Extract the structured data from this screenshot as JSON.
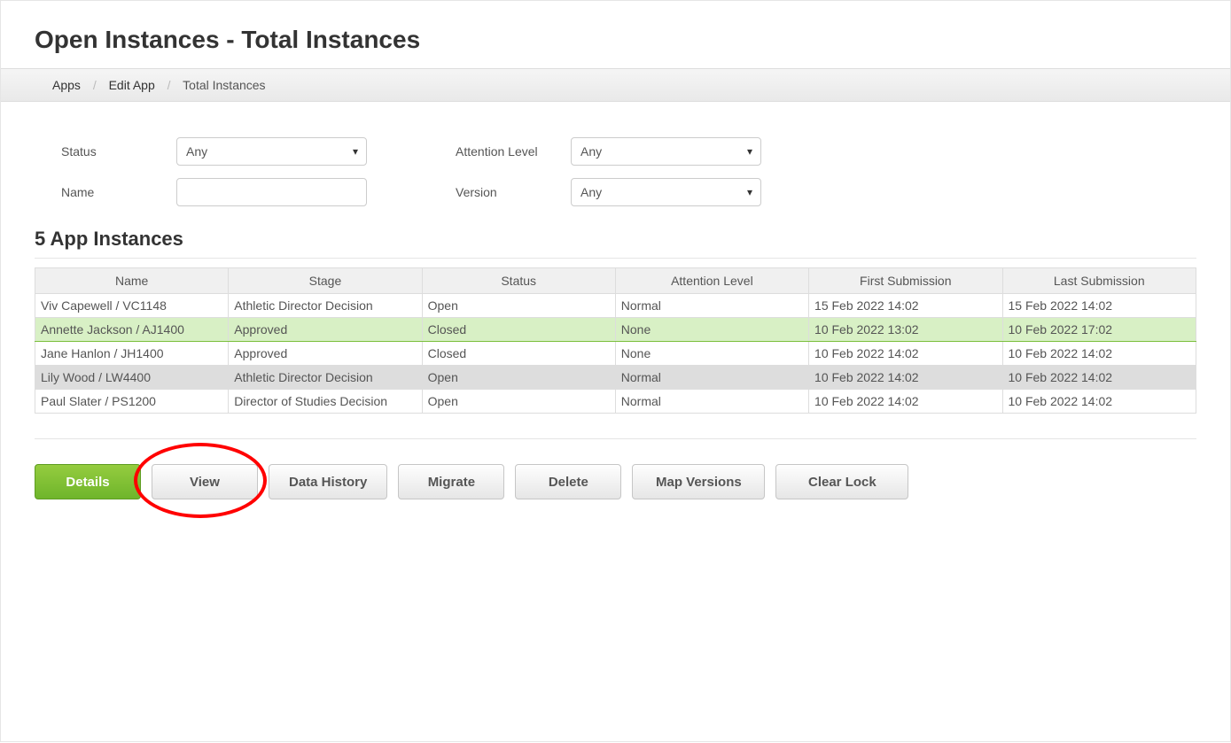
{
  "page_title": "Open Instances - Total Instances",
  "breadcrumb": {
    "root": "Apps",
    "mid": "Edit App",
    "leaf": "Total Instances"
  },
  "filters": {
    "status_label": "Status",
    "status_value": "Any",
    "name_label": "Name",
    "name_value": "",
    "attention_label": "Attention Level",
    "attention_value": "Any",
    "version_label": "Version",
    "version_value": "Any"
  },
  "instances_title": "5 App Instances",
  "table": {
    "headers": {
      "name": "Name",
      "stage": "Stage",
      "status": "Status",
      "attention": "Attention Level",
      "first": "First Submission",
      "last": "Last Submission"
    },
    "rows": [
      {
        "name": "Viv Capewell / VC1148",
        "stage": "Athletic Director Decision",
        "status": "Open",
        "attention": "Normal",
        "first": "15 Feb 2022 14:02",
        "last": "15 Feb 2022 14:02",
        "row_class": ""
      },
      {
        "name": "Annette Jackson / AJ1400",
        "stage": "Approved",
        "status": "Closed",
        "attention": "None",
        "first": "10 Feb 2022 13:02",
        "last": "10 Feb 2022 17:02",
        "row_class": "row-green"
      },
      {
        "name": "Jane Hanlon / JH1400",
        "stage": "Approved",
        "status": "Closed",
        "attention": "None",
        "first": "10 Feb 2022 14:02",
        "last": "10 Feb 2022 14:02",
        "row_class": ""
      },
      {
        "name": "Lily Wood / LW4400",
        "stage": "Athletic Director Decision",
        "status": "Open",
        "attention": "Normal",
        "first": "10 Feb 2022 14:02",
        "last": "10 Feb 2022 14:02",
        "row_class": "row-grey"
      },
      {
        "name": "Paul Slater / PS1200",
        "stage": "Director of Studies Decision",
        "status": "Open",
        "attention": "Normal",
        "first": "10 Feb 2022 14:02",
        "last": "10 Feb 2022 14:02",
        "row_class": ""
      }
    ]
  },
  "buttons": {
    "details": "Details",
    "view": "View",
    "data_history": "Data History",
    "migrate": "Migrate",
    "delete": "Delete",
    "map_versions": "Map Versions",
    "clear_lock": "Clear Lock"
  }
}
